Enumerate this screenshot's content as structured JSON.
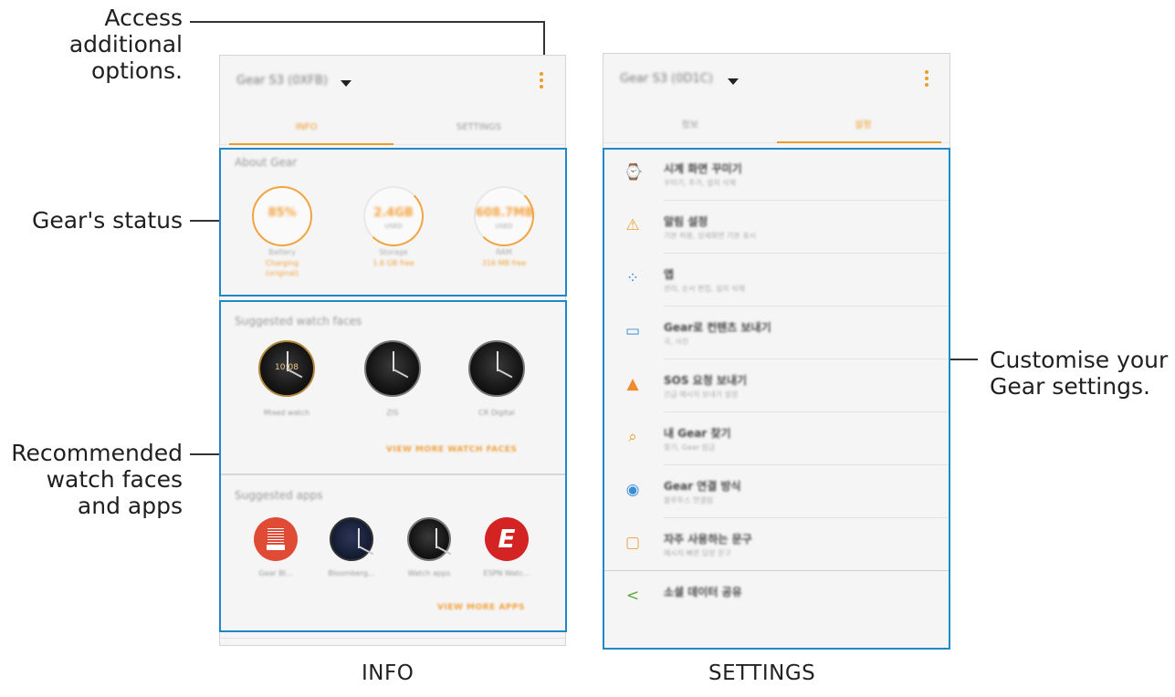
{
  "annotations": {
    "access_options": "Access\nadditional\noptions.",
    "gear_status": "Gear's status",
    "recommended": "Recommended\nwatch faces\nand apps",
    "customise": "Customise your\nGear settings."
  },
  "captions": {
    "info": "INFO",
    "settings": "SETTINGS"
  },
  "info_screen": {
    "device_name": "Gear S3 (0XFB)",
    "tabs": [
      "INFO",
      "SETTINGS"
    ],
    "about_title": "About Gear",
    "status": [
      {
        "value": "85%",
        "sub": "",
        "label": "Battery",
        "stat": "Charging\n(original)"
      },
      {
        "value": "2.4GB",
        "sub": "USED",
        "label": "Storage",
        "stat": "1.6 GB free"
      },
      {
        "value": "608.7MB",
        "sub": "USED",
        "label": "RAM",
        "stat": "316 MB free"
      }
    ],
    "watchfaces_title": "Suggested watch faces",
    "watchfaces": [
      {
        "name": "Mixed watch",
        "digits": "10:08"
      },
      {
        "name": "ZIS",
        "digits": ""
      },
      {
        "name": "CR Digital",
        "digits": ""
      }
    ],
    "view_more_faces": "VIEW MORE WATCH FACES",
    "apps_title": "Suggested apps",
    "apps": [
      {
        "name": "Gear Bl..."
      },
      {
        "name": "Bloomberg..."
      },
      {
        "name": "Watch apps"
      },
      {
        "name": "ESPN Watc..."
      }
    ],
    "view_more_apps": "VIEW MORE APPS"
  },
  "settings_screen": {
    "device_name": "Gear S3 (0D1C)",
    "tabs": [
      "정보",
      "설정"
    ],
    "rows": [
      {
        "icon": "watch-icon",
        "color": "#e8a23a",
        "title": "시계 화면 꾸미기",
        "sub": "꾸미기, 추가, 설치 삭제"
      },
      {
        "icon": "notification-icon",
        "color": "#e8a23a",
        "title": "알림 설정",
        "sub": "기본 허용, 상세화면 기본 표시"
      },
      {
        "icon": "apps-icon",
        "color": "#3b8fd8",
        "title": "앱",
        "sub": "관리, 순서 편집, 설치 삭제"
      },
      {
        "icon": "folder-transfer-icon",
        "color": "#3b8fd8",
        "title": "Gear로 컨텐츠 보내기",
        "sub": "곡, 사진"
      },
      {
        "icon": "siren-icon",
        "color": "#f08a2a",
        "title": "SOS 요청 보내기",
        "sub": "긴급 메시지 보내기 설정"
      },
      {
        "icon": "find-gear-icon",
        "color": "#e8a23a",
        "title": "내 Gear 찾기",
        "sub": "찾기, Gear 잠금"
      },
      {
        "icon": "gear-connection-icon",
        "color": "#3b8fd8",
        "title": "Gear 연결 방식",
        "sub": "블루투스 연결됨"
      },
      {
        "icon": "quick-reply-icon",
        "color": "#e8a23a",
        "title": "자주 사용하는 문구",
        "sub": "메시지 빠른 답장 문구"
      },
      {
        "icon": "share-icon",
        "color": "#5aa83c",
        "title": "소셜 데이터 공유",
        "sub": ""
      }
    ]
  },
  "colors": {
    "accent": "#f09a2a",
    "highlight": "#1e88c8"
  }
}
